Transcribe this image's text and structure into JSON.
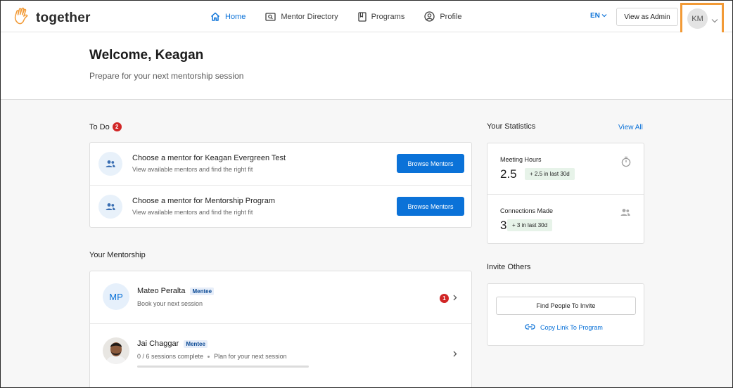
{
  "app": {
    "logo_text": "together"
  },
  "nav": {
    "items": [
      {
        "label": "Home",
        "icon": "home-icon"
      },
      {
        "label": "Mentor Directory",
        "icon": "mentor-directory-icon"
      },
      {
        "label": "Programs",
        "icon": "book-icon"
      },
      {
        "label": "Profile",
        "icon": "profile-icon"
      }
    ],
    "lang": "EN",
    "admin_label": "View as Admin",
    "avatar_initials": "KM"
  },
  "welcome": {
    "title": "Welcome, Keagan",
    "subtitle": "Prepare for your next mentorship session"
  },
  "todo": {
    "title": "To Do",
    "count": "2",
    "items": [
      {
        "title": "Choose a mentor for Keagan Evergreen Test",
        "sub": "View available mentors and find the right fit",
        "button": "Browse Mentors"
      },
      {
        "title": "Choose a mentor for Mentorship Program",
        "sub": "View available mentors and find the right fit",
        "button": "Browse Mentors"
      }
    ]
  },
  "mentorship": {
    "title": "Your Mentorship",
    "items": [
      {
        "initials": "MP",
        "name": "Mateo Peralta",
        "tag": "Mentee",
        "sub": "Book your next session",
        "badge": "1"
      },
      {
        "name": "Jai Chaggar",
        "tag": "Mentee",
        "sessions": "0 / 6 sessions complete",
        "plan": "Plan for your next session",
        "progress": 0
      }
    ]
  },
  "stats": {
    "title": "Your Statistics",
    "view_all": "View All",
    "items": [
      {
        "label": "Meeting Hours",
        "value": "2.5",
        "delta": "+ 2.5 in last 30d",
        "icon": "timer-icon"
      },
      {
        "label": "Connections Made",
        "value": "3",
        "delta": "+ 3 in last 30d",
        "icon": "people-icon"
      }
    ]
  },
  "invite": {
    "title": "Invite Others",
    "find_label": "Find People To Invite",
    "copy_label": "Copy Link To Program"
  },
  "colors": {
    "accent": "#0b72d8",
    "highlight": "#f29a36",
    "badge": "#d12626"
  }
}
